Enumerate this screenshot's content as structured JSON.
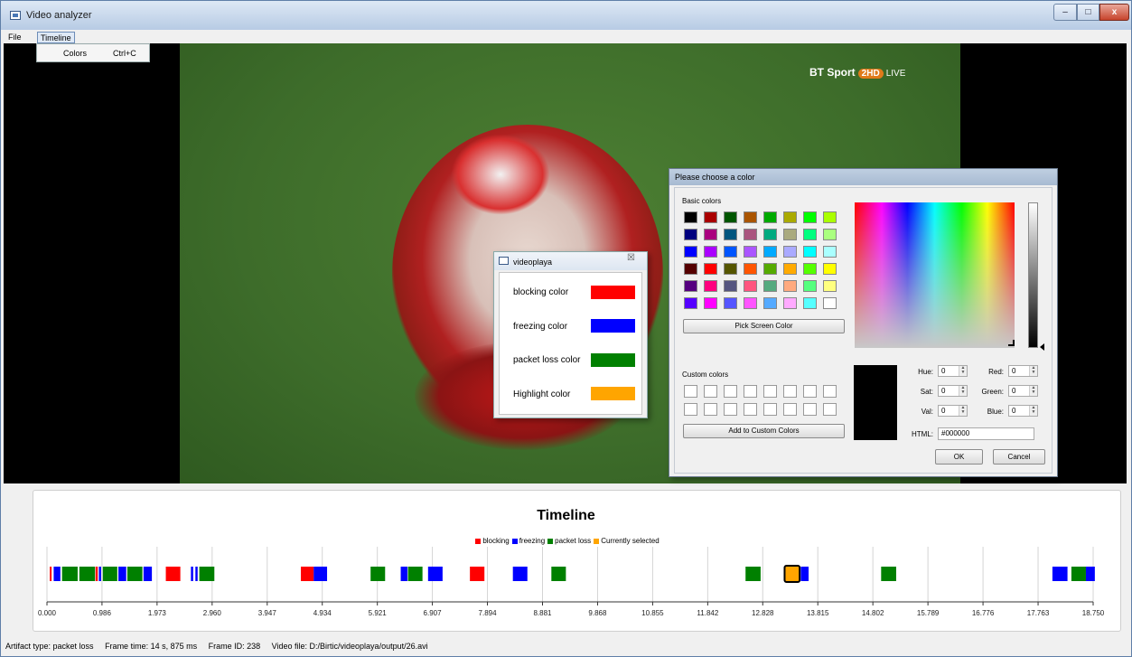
{
  "window": {
    "title": "Video analyzer",
    "minimize_glyph": "–",
    "maximize_glyph": "□",
    "close_glyph": "x"
  },
  "menu": {
    "file": "File",
    "timeline": "Timeline",
    "dropdown": {
      "label": "Colors",
      "shortcut": "Ctrl+C"
    }
  },
  "video": {
    "broadcaster": "BT Sport",
    "badge": "2HD",
    "live": "LIVE"
  },
  "timeline": {
    "title": "Timeline",
    "legend": [
      {
        "label": "blocking",
        "color": "#ff0000"
      },
      {
        "label": "freezing",
        "color": "#0000ff"
      },
      {
        "label": "packet loss",
        "color": "#008000"
      },
      {
        "label": "Currently selected",
        "color": "#ffa500"
      }
    ],
    "ticks": [
      "0.000",
      "0.986",
      "1.973",
      "2.960",
      "3.947",
      "4.934",
      "5.921",
      "6.907",
      "7.894",
      "8.881",
      "9.868",
      "10.855",
      "11.842",
      "12.828",
      "13.815",
      "14.802",
      "15.789",
      "16.776",
      "17.763",
      "18.750"
    ],
    "range": [
      0,
      18.75
    ],
    "events": [
      {
        "t": 0.05,
        "type": "blocking",
        "w": 0.03
      },
      {
        "t": 0.12,
        "type": "freezing",
        "w": 0.12
      },
      {
        "t": 0.27,
        "type": "packet loss",
        "w": 0.28
      },
      {
        "t": 0.58,
        "type": "packet loss",
        "w": 0.28
      },
      {
        "t": 0.87,
        "type": "blocking",
        "w": 0.04
      },
      {
        "t": 0.93,
        "type": "freezing",
        "w": 0.04
      },
      {
        "t": 1.0,
        "type": "packet loss",
        "w": 0.26
      },
      {
        "t": 1.28,
        "type": "freezing",
        "w": 0.14
      },
      {
        "t": 1.44,
        "type": "packet loss",
        "w": 0.27
      },
      {
        "t": 1.73,
        "type": "freezing",
        "w": 0.15
      },
      {
        "t": 2.13,
        "type": "blocking",
        "w": 0.26
      },
      {
        "t": 2.58,
        "type": "freezing",
        "w": 0.04
      },
      {
        "t": 2.66,
        "type": "freezing",
        "w": 0.04
      },
      {
        "t": 2.73,
        "type": "packet loss",
        "w": 0.27
      },
      {
        "t": 4.55,
        "type": "blocking",
        "w": 0.23
      },
      {
        "t": 4.78,
        "type": "freezing",
        "w": 0.24
      },
      {
        "t": 5.8,
        "type": "packet loss",
        "w": 0.26
      },
      {
        "t": 6.34,
        "type": "freezing",
        "w": 0.12
      },
      {
        "t": 6.47,
        "type": "packet loss",
        "w": 0.26
      },
      {
        "t": 6.83,
        "type": "freezing",
        "w": 0.26
      },
      {
        "t": 7.58,
        "type": "blocking",
        "w": 0.26
      },
      {
        "t": 8.35,
        "type": "freezing",
        "w": 0.26
      },
      {
        "t": 9.04,
        "type": "packet loss",
        "w": 0.26
      },
      {
        "t": 12.52,
        "type": "packet loss",
        "w": 0.27
      },
      {
        "t": 13.22,
        "type": "selected",
        "w": 0.27
      },
      {
        "t": 13.51,
        "type": "freezing",
        "w": 0.14
      },
      {
        "t": 14.95,
        "type": "packet loss",
        "w": 0.27
      },
      {
        "t": 18.02,
        "type": "freezing",
        "w": 0.27
      },
      {
        "t": 18.36,
        "type": "packet loss",
        "w": 0.26
      },
      {
        "t": 18.62,
        "type": "freezing",
        "w": 0.16
      }
    ]
  },
  "status": {
    "artifact_type": "Artifact type: packet loss",
    "frame_time": "Frame time: 14 s, 875 ms",
    "frame_id": "Frame ID: 238",
    "video_file": "Video file: D:/Birtic/videoplaya/output/26.avi"
  },
  "videoplaya_dialog": {
    "title": "videoplaya",
    "close_glyph": "☒",
    "rows": [
      {
        "label": "blocking color",
        "color": "#ff0000"
      },
      {
        "label": "freezing color",
        "color": "#0000ff"
      },
      {
        "label": "packet loss color",
        "color": "#008000"
      },
      {
        "label": "Highlight color",
        "color": "#ffa500"
      }
    ]
  },
  "color_dialog": {
    "title": "Please choose a color",
    "basic_colors_label": "Basic colors",
    "basic_colors": [
      [
        "#000000",
        "#aa0000",
        "#005500",
        "#aa5500",
        "#00aa00",
        "#aaaa00",
        "#00ff00",
        "#aaff00"
      ],
      [
        "#00007f",
        "#aa007f",
        "#00557f",
        "#aa557f",
        "#00aa7f",
        "#aaaa7f",
        "#00ff7f",
        "#aaff7f"
      ],
      [
        "#0000ff",
        "#aa00ff",
        "#0055ff",
        "#aa55ff",
        "#00aaff",
        "#aaaaff",
        "#00ffff",
        "#aaffff"
      ],
      [
        "#550000",
        "#ff0000",
        "#555500",
        "#ff5500",
        "#55aa00",
        "#ffaa00",
        "#55ff00",
        "#ffff00"
      ],
      [
        "#55007f",
        "#ff007f",
        "#55557f",
        "#ff557f",
        "#55aa7f",
        "#ffaa7f",
        "#55ff7f",
        "#ffff7f"
      ],
      [
        "#5500ff",
        "#ff00ff",
        "#5555ff",
        "#ff55ff",
        "#55aaff",
        "#ffaaff",
        "#55ffff",
        "#ffffff"
      ]
    ],
    "pick_screen": "Pick Screen Color",
    "custom_colors_label": "Custom colors",
    "add_custom": "Add to Custom Colors",
    "hue_label": "Hue:",
    "hue": "0",
    "sat_label": "Sat:",
    "sat": "0",
    "val_label": "Val:",
    "val": "0",
    "red_label": "Red:",
    "red": "0",
    "green_label": "Green:",
    "green": "0",
    "blue_label": "Blue:",
    "blue": "0",
    "html_label": "HTML:",
    "html": "#000000",
    "ok": "OK",
    "cancel": "Cancel"
  }
}
